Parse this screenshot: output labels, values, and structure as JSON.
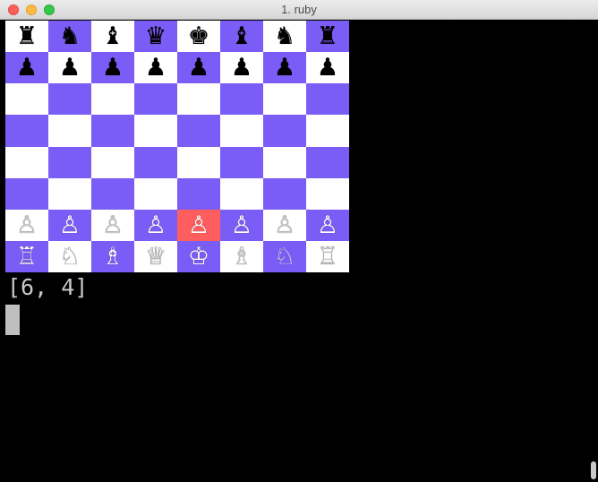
{
  "window": {
    "title": "1. ruby"
  },
  "board": {
    "colors": {
      "light": "#ffffff",
      "dark": "#7a5cf6",
      "highlight": "#ff5e5e"
    },
    "highlight": [
      6,
      4
    ],
    "rows": [
      [
        "♜",
        "♞",
        "♝",
        "♛",
        "♚",
        "♝",
        "♞",
        "♜"
      ],
      [
        "♟",
        "♟",
        "♟",
        "♟",
        "♟",
        "♟",
        "♟",
        "♟"
      ],
      [
        "",
        "",
        "",
        "",
        "",
        "",
        "",
        ""
      ],
      [
        "",
        "",
        "",
        "",
        "",
        "",
        "",
        ""
      ],
      [
        "",
        "",
        "",
        "",
        "",
        "",
        "",
        ""
      ],
      [
        "",
        "",
        "",
        "",
        "",
        "",
        "",
        ""
      ],
      [
        "♙",
        "♙",
        "♙",
        "♙",
        "♙",
        "♙",
        "♙",
        "♙"
      ],
      [
        "♖",
        "♘",
        "♗",
        "♕",
        "♔",
        "♗",
        "♘",
        "♖"
      ]
    ]
  },
  "terminal": {
    "output": "[6, 4]"
  }
}
